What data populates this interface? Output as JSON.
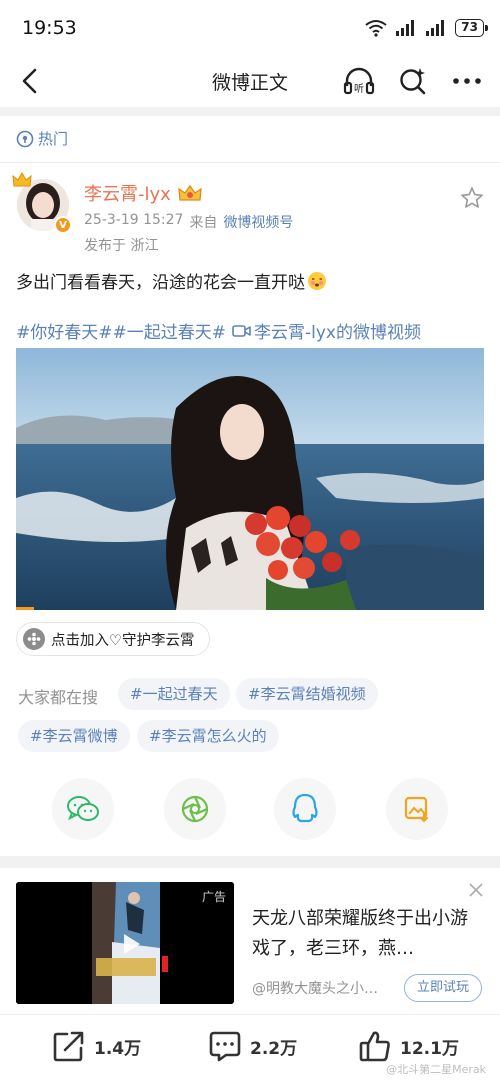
{
  "status_bar": {
    "time": "19:53",
    "battery": "73"
  },
  "nav": {
    "title": "微博正文"
  },
  "hot": {
    "label": "热门"
  },
  "post": {
    "username": "李云霄-lyx",
    "time": "25-3-19 15:27",
    "source_prefix": "来自",
    "source": "微博视频号",
    "location": "发布于 浙江",
    "text": "多出门看看春天，沿途的花会一直开哒",
    "topics": "#你好春天##一起过春天#",
    "video_link": "李云霄-lyx的微博视频"
  },
  "guard": {
    "label": "点击加入♡守护李云霄"
  },
  "search": {
    "label": "大家都在搜",
    "tags": [
      "#一起过春天",
      "#李云霄结婚视频",
      "#李云霄微博",
      "#李云霄怎么火的"
    ]
  },
  "share": {
    "icons": [
      "wechat-icon",
      "moments-icon",
      "qq-icon",
      "save-image-icon"
    ]
  },
  "ad": {
    "badge": "广告",
    "title": "天龙八部荣耀版终于出小游戏了，老三环，燕…",
    "author": "@明教大魔头之小…",
    "cta": "立即试玩"
  },
  "actions": {
    "repost": "1.4万",
    "comment": "2.2万",
    "like": "12.1万"
  },
  "watermark": "@北斗第二星Merak",
  "colors": {
    "accent": "#eb7350",
    "link": "#5a82b8",
    "meta": "#939393"
  }
}
